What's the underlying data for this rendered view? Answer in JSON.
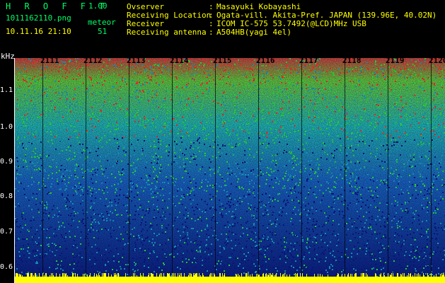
{
  "header": {
    "app_name": "H R O F F T",
    "app_version": "1.00",
    "file_name": "1011162110.png",
    "timestamp": "10.11.16 21:10",
    "meteor_label": "meteor",
    "meteor_count": "51"
  },
  "info": {
    "observer_label": "Ovserver",
    "observer_value": "Masayuki Kobayashi",
    "location_label": "Receiving Location",
    "location_value": "Ogata-vill. Akita-Pref. JAPAN (139.96E, 40.02N)",
    "receiver_label": "Receiver",
    "receiver_value": "ICOM IC-575 53.7492(@LCD)MHz USB",
    "antenna_label": "Receiving antenna",
    "antenna_value": "A504HB(yagi 4el)",
    "colon": ":"
  },
  "spectrogram": {
    "freq_unit": "kHz",
    "y_ticks": [
      "1.1",
      "1.0",
      "0.9",
      "0.8",
      "0.7",
      "0.6"
    ],
    "x_ticks": [
      "2111",
      "2112",
      "2113",
      "2114",
      "2115",
      "2116",
      "2117",
      "2118",
      "2119",
      "2120"
    ],
    "colors": {
      "low": "#0a1a8a",
      "mid": "#1ca0c8",
      "high": "#30e040",
      "peak": "#ff3030",
      "strip": "#ffff00"
    }
  }
}
